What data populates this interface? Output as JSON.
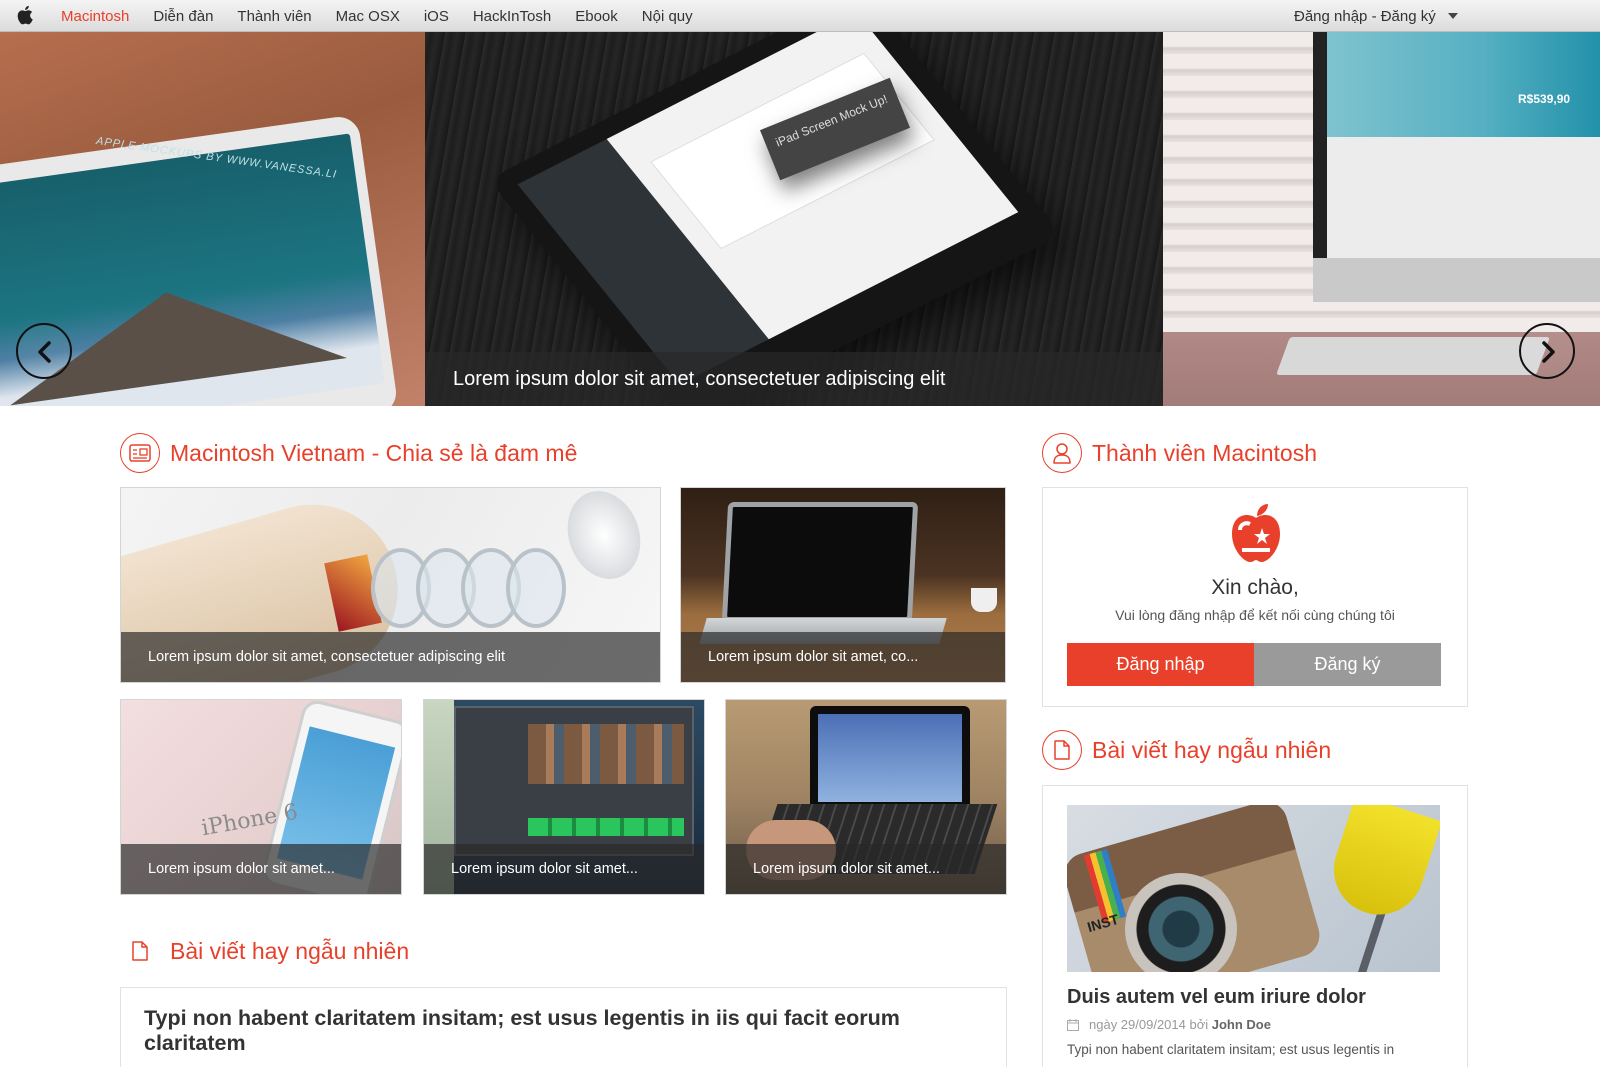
{
  "topbar": {
    "nav": [
      {
        "label": "Macintosh",
        "active": true
      },
      {
        "label": "Diễn đàn",
        "active": false
      },
      {
        "label": "Thành viên",
        "active": false
      },
      {
        "label": "Mac OSX",
        "active": false
      },
      {
        "label": "iOS",
        "active": false
      },
      {
        "label": "HackInTosh",
        "active": false
      },
      {
        "label": "Ebook",
        "active": false
      },
      {
        "label": "Nội quy",
        "active": false
      }
    ],
    "auth_label": "Đăng nhập - Đăng ký"
  },
  "slider": {
    "caption": "Lorem ipsum dolor sit amet, consectetuer adipiscing elit",
    "left_slide_text": "APPLE MOCKUPS BY WWW.VANESSA.LI",
    "mid_slide_tag": "iPad Screen Mock Up!",
    "right_slide_price": "R$539,90"
  },
  "main": {
    "section_title": "Macintosh Vietnam - Chia sẻ là đam mê",
    "tiles": [
      {
        "caption": "Lorem ipsum dolor sit amet, consectetuer adipiscing elit"
      },
      {
        "caption": "Lorem ipsum dolor sit amet, co..."
      },
      {
        "caption": "Lorem ipsum dolor sit amet..."
      },
      {
        "caption": "Lorem ipsum dolor sit amet..."
      },
      {
        "caption": "Lorem ipsum dolor sit amet..."
      }
    ],
    "tile3_box_text": "iPhone 6",
    "random_section_title": "Bài viết hay ngẫu nhiên",
    "article": {
      "title": "Typi non habent claritatem insitam; est usus legentis in iis qui facit eorum claritatem"
    }
  },
  "sidebar": {
    "member_title": "Thành viên Macintosh",
    "hello": "Xin chào,",
    "hello_sub": "Vui lòng đăng nhập để kết nối cùng chúng tôi",
    "login_label": "Đăng nhập",
    "register_label": "Đăng ký",
    "random_title": "Bài viết hay ngẫu nhiên",
    "random_post": {
      "image_text": "INST",
      "title": "Duis autem vel eum iriure dolor",
      "date_prefix": "ngày 29/09/2014 bởi",
      "author": "John Doe",
      "excerpt": "Typi non habent claritatem insitam; est usus legentis in"
    }
  },
  "colors": {
    "accent": "#e8402a",
    "register_button": "#9a9a9a"
  },
  "icons": {
    "apple": "apple-icon",
    "prev": "chevron-left-icon",
    "next": "chevron-right-icon",
    "section_main": "photo-card-icon",
    "section_member": "user-icon",
    "section_random": "document-icon",
    "calendar": "calendar-icon"
  }
}
